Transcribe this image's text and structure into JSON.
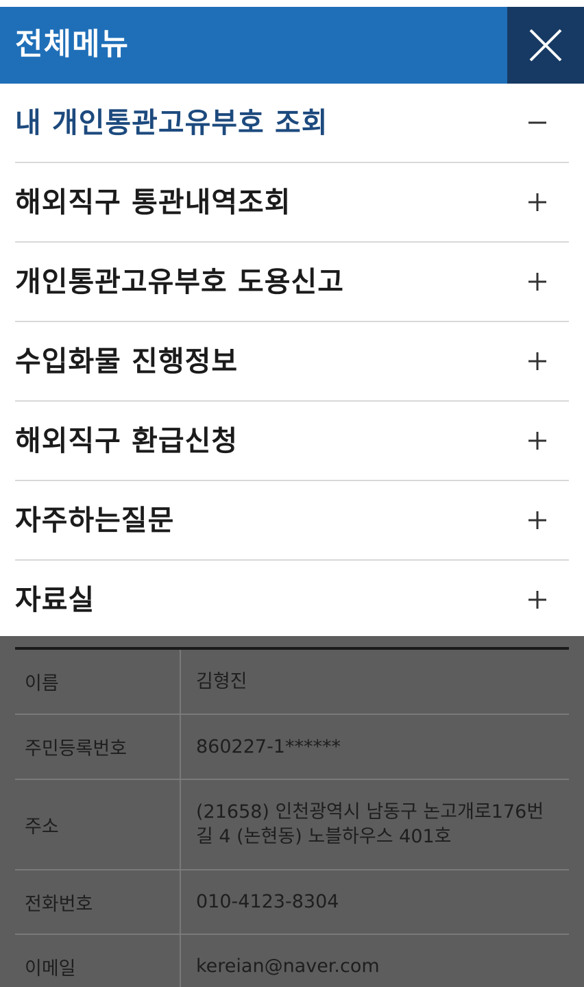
{
  "header": {
    "title": "전체메뉴",
    "close_icon": "close-icon"
  },
  "menu": {
    "items": [
      {
        "label": "내 개인통관고유부호 조회",
        "toggle": "−",
        "expanded": true
      },
      {
        "label": "해외직구 통관내역조회",
        "toggle": "+",
        "expanded": false
      },
      {
        "label": "개인통관고유부호 도용신고",
        "toggle": "+",
        "expanded": false
      },
      {
        "label": "수입화물 진행정보",
        "toggle": "+",
        "expanded": false
      },
      {
        "label": "해외직구 환급신청",
        "toggle": "+",
        "expanded": false
      },
      {
        "label": "자주하는질문",
        "toggle": "+",
        "expanded": false
      },
      {
        "label": "자료실",
        "toggle": "+",
        "expanded": false
      }
    ]
  },
  "info": {
    "rows": [
      {
        "label": "이름",
        "value": "김형진"
      },
      {
        "label": "주민등록번호",
        "value": "860227-1******"
      },
      {
        "label": "주소",
        "value_line1": "(21658)  인천광역시 남동구 논고개로176번",
        "value_line2": "길 4 (논현동) 노블하우스 401호"
      },
      {
        "label": "전화번호",
        "value": "010-4123-8304"
      },
      {
        "label": "이메일",
        "value": "kereian@naver.com"
      }
    ]
  },
  "colors": {
    "header_bg": "#1f6fb8",
    "close_bg": "#163a63",
    "active_text": "#1d4a7e",
    "overlay_bg": "#5d5d5d"
  }
}
